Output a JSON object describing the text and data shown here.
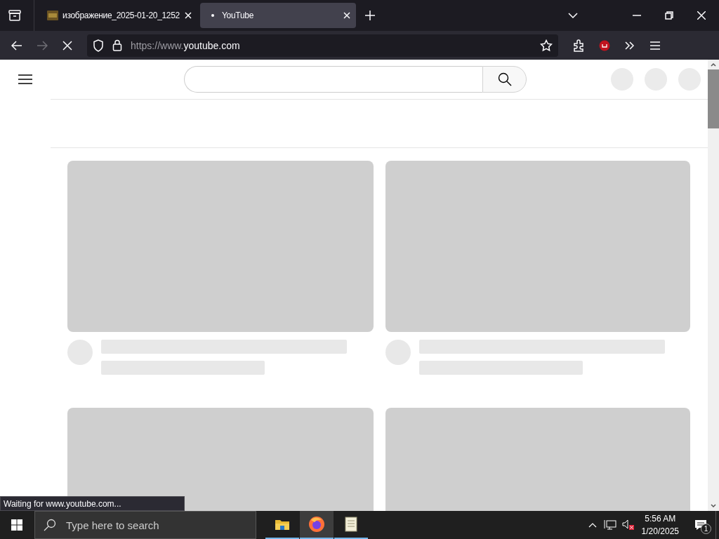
{
  "tabs": [
    {
      "title": "изображение_2025-01-20_1252",
      "selected": false
    },
    {
      "title": "YouTube",
      "selected": true
    }
  ],
  "address_bar": {
    "scheme": "https://www.",
    "host": "youtube.com"
  },
  "status_text": "Waiting for www.youtube.com...",
  "taskbar": {
    "search_placeholder": "Type here to search",
    "apps": [
      {
        "kind": "folder",
        "selected": false
      },
      {
        "kind": "firefox",
        "selected": true
      },
      {
        "kind": "notepad",
        "selected": false
      }
    ],
    "time": "5:56 AM",
    "date": "1/20/2025",
    "notification_count": "1"
  }
}
